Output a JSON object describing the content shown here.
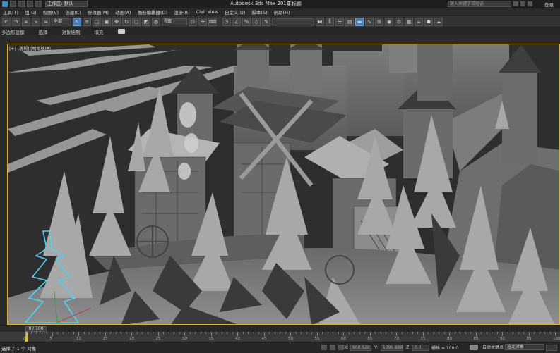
{
  "titlebar": {
    "workspace_label": "工作区: 默认",
    "app_title": "Autodesk 3ds Max 2016",
    "file_title": "无标题",
    "search_placeholder": "键入关键字或短语",
    "login": "登录"
  },
  "menu": [
    "工具(T)",
    "组(G)",
    "视图(V)",
    "创建(C)",
    "修改器(M)",
    "动画(A)",
    "图形编辑器(D)",
    "渲染(R)",
    "Civil View",
    "自定义(U)",
    "脚本(S)",
    "帮助(H)"
  ],
  "toolbar": {
    "selection_filter": "全部",
    "ref_coord": "视图",
    "named_set": ""
  },
  "ribbon": {
    "items": [
      "多边形建模",
      "选择",
      "对象绘制",
      "填充"
    ]
  },
  "viewport": {
    "label": "[+] [透视] [明暗处理]"
  },
  "timeline": {
    "frame_label": "0 / 100",
    "ticks": [
      "0",
      "5",
      "10",
      "15",
      "20",
      "25",
      "30",
      "35",
      "40",
      "45",
      "50",
      "55",
      "60",
      "65",
      "70",
      "75",
      "80",
      "85",
      "90",
      "95",
      "100"
    ]
  },
  "status": {
    "selection": "选择了 1 个 对象",
    "x_label": "X:",
    "x_value": "800.528",
    "y_label": "Y:",
    "y_value": "1099.888",
    "z_label": "Z:",
    "z_value": "0.0",
    "grid": "栅格 = 100.0",
    "autokey": "自动关键点",
    "selection_set": "选定对象"
  }
}
